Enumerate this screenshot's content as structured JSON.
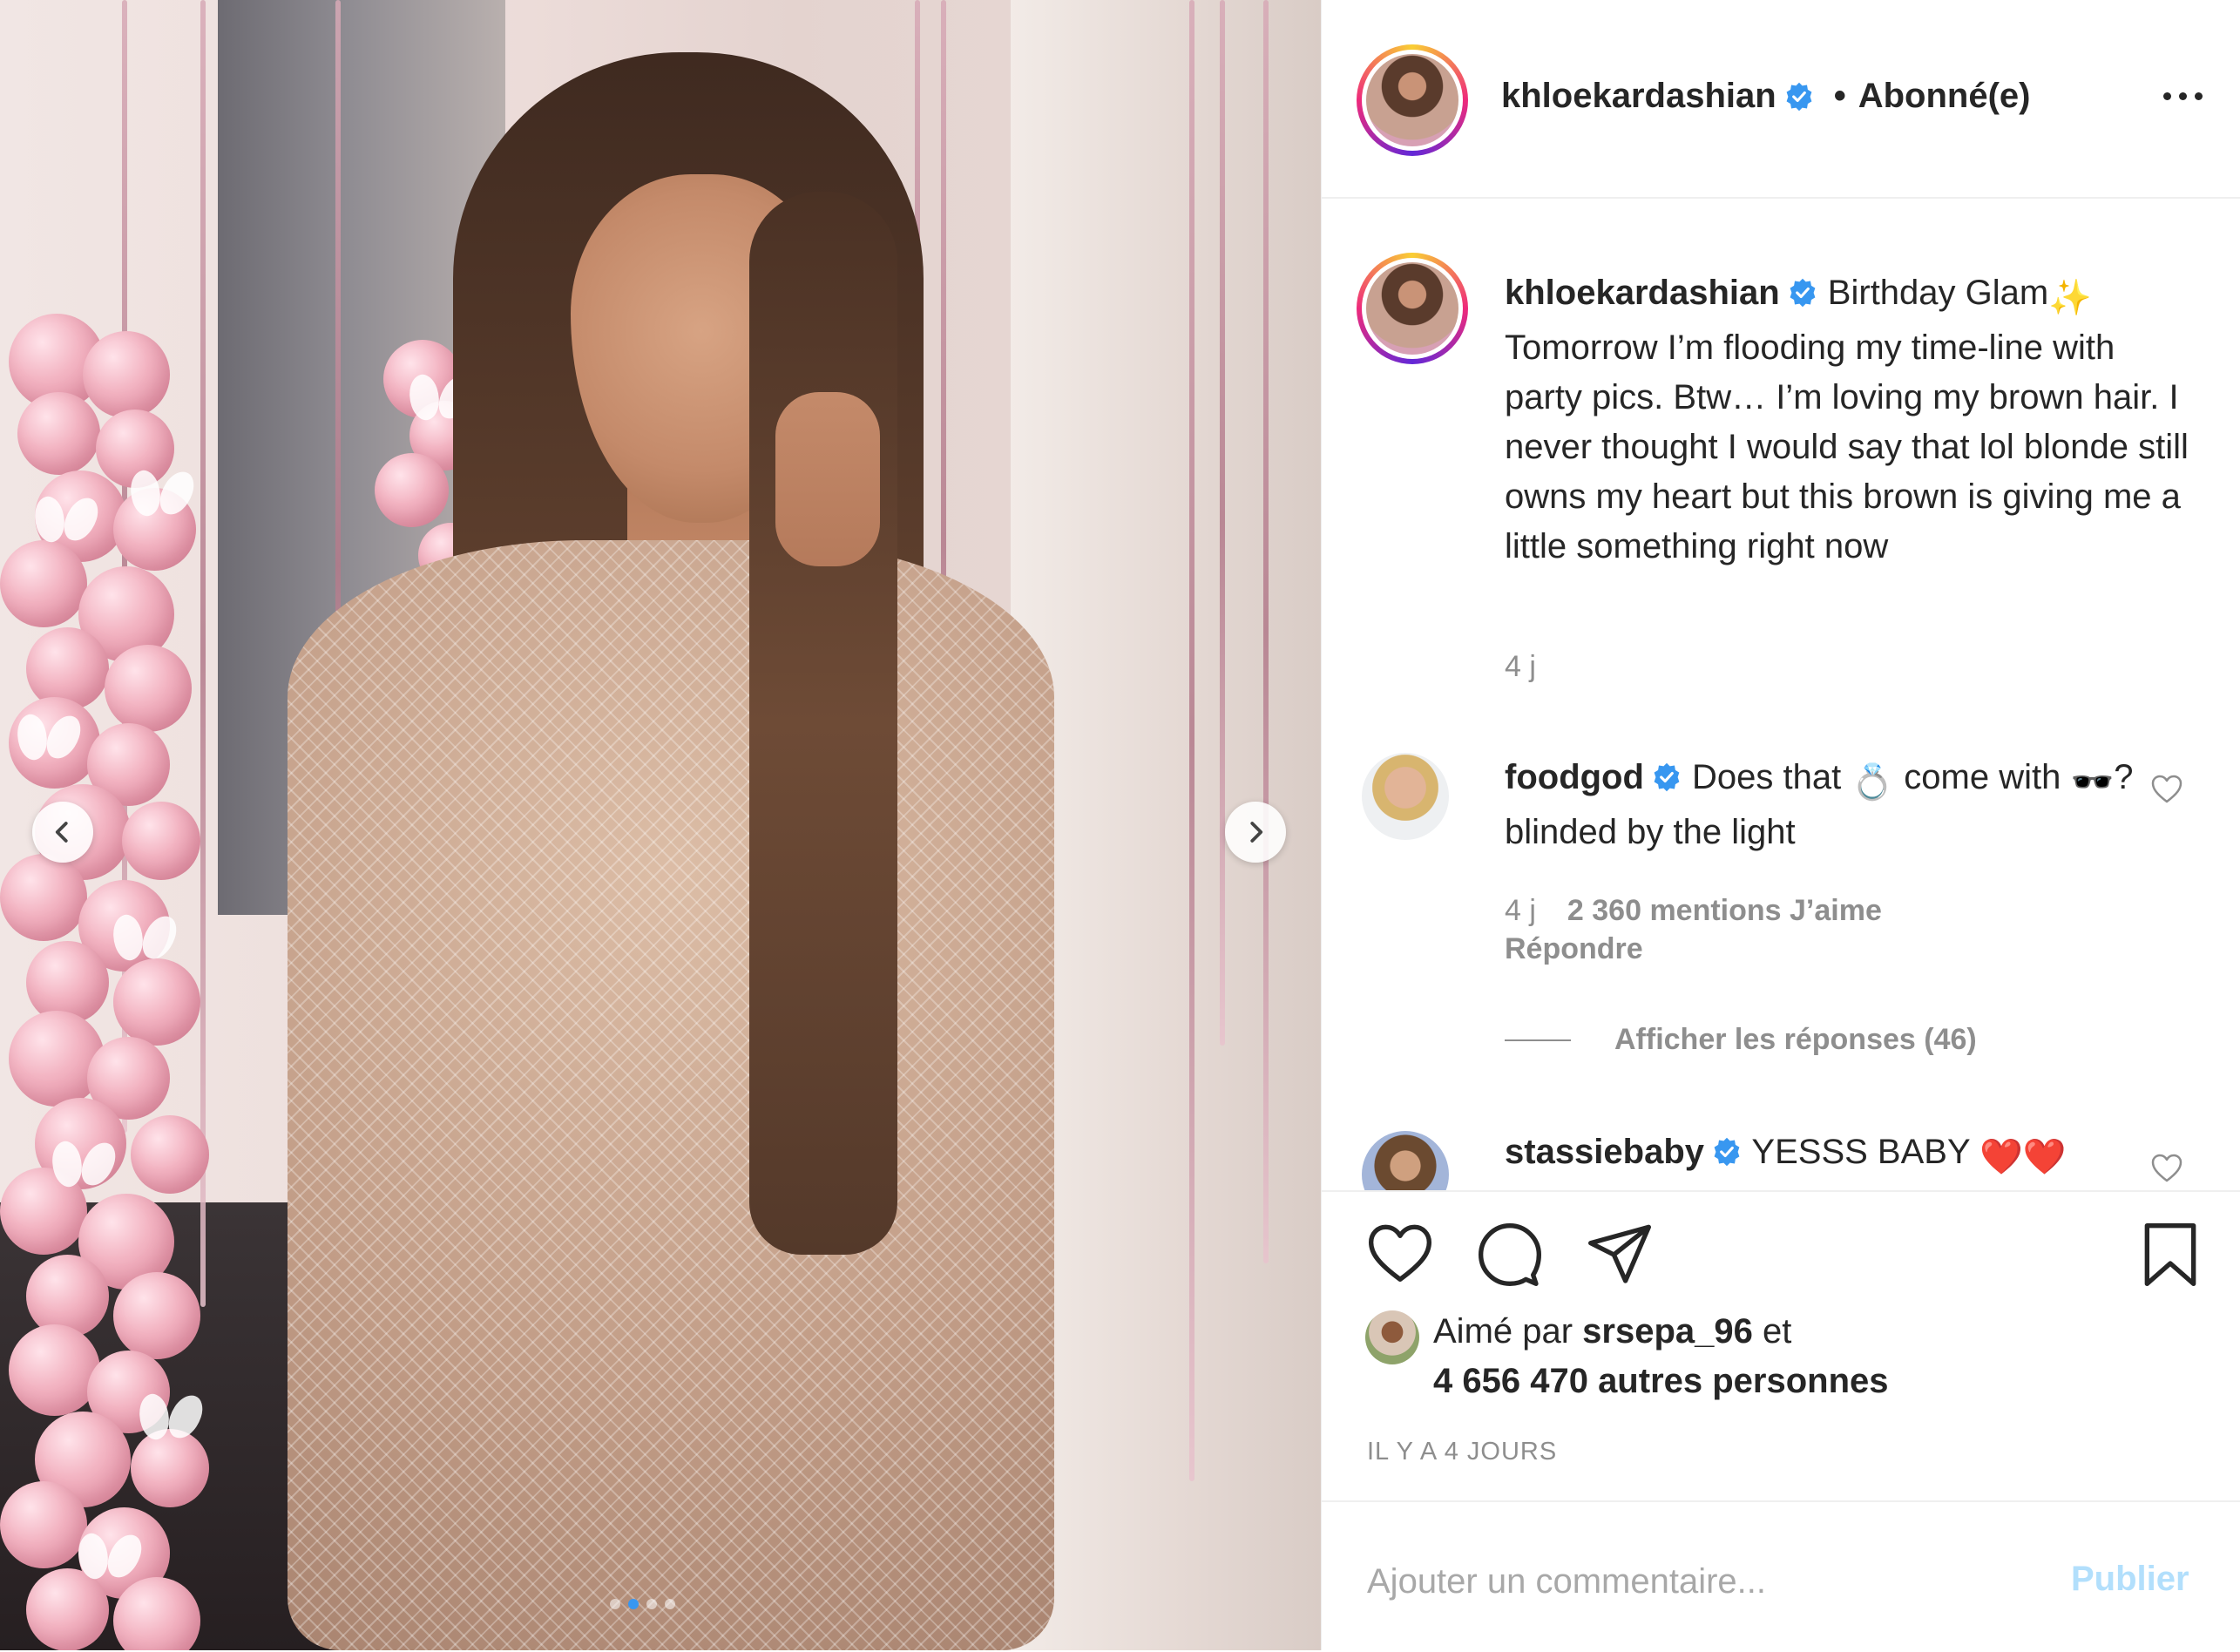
{
  "post": {
    "photo": {
      "alt": "",
      "carousel_index": 2,
      "carousel_count": 4
    },
    "author": {
      "username": "khloekardashian",
      "verified": true,
      "follow_state": "Abonné(e)",
      "bullet": "•"
    },
    "caption": {
      "username": "khloekardashian",
      "text_part1": " Birthday Glam",
      "emoji1": "✨",
      "text_part2": "Tomorrow I’m flooding my time-line with party pics. Btw… I’m loving my brown hair. I never thought I would say that lol blonde still owns my heart but this brown is giving me a little something right now",
      "age": "4 j"
    },
    "comments": [
      {
        "username": "foodgod",
        "verified": true,
        "text_part1": " Does that ",
        "emoji1": "💍",
        "text_part2": " come with ",
        "emoji2": "🕶️",
        "text_part3": "? blinded by the light",
        "age": "4 j",
        "likes": "2 360 mentions J’aime",
        "reply_label": "Répondre",
        "view_replies": "Afficher les réponses (46)"
      },
      {
        "username": "stassiebaby",
        "verified": true,
        "text": " YESSS BABY ",
        "emoji": "❤️❤️"
      }
    ],
    "likes": {
      "prefix": "Aimé par ",
      "liker": "srsepa_96",
      "connector": " et",
      "others": "4 656 470 autres personnes"
    },
    "timestamp": "IL Y A 4 JOURS",
    "add_comment": {
      "placeholder": "Ajouter un commentaire...",
      "publish_label": "Publier"
    }
  },
  "icons": {
    "like": "heart-icon",
    "comment": "comment-bubble-icon",
    "share": "paper-plane-icon",
    "save": "bookmark-icon",
    "more": "ellipsis-icon",
    "prev": "chevron-left-icon",
    "next": "chevron-right-icon",
    "verified": "verified-badge-icon"
  },
  "colors": {
    "verified_blue": "#3897f0",
    "secondary_text": "#8e8e8e",
    "publish_disabled": "#b2dffc",
    "heart_red": "#ed4956"
  }
}
